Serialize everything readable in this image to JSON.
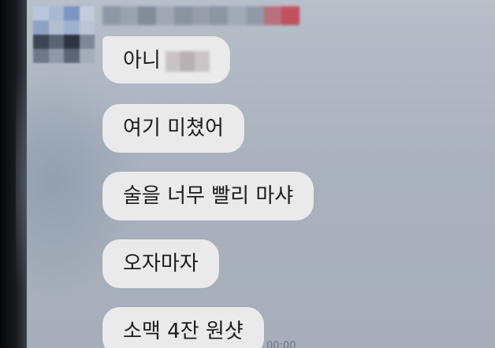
{
  "chat": {
    "messages": [
      {
        "text": "아니"
      },
      {
        "text": "여기 미쳤어"
      },
      {
        "text": "술을 너무 빨리 마샤"
      },
      {
        "text": "오자마자"
      },
      {
        "text": "소맥 4잔 원샷"
      }
    ],
    "time_partial": "00:00"
  },
  "colors": {
    "background": "#a9b2bd",
    "bubble": "#eaeaea",
    "text": "#1c1c1c"
  }
}
